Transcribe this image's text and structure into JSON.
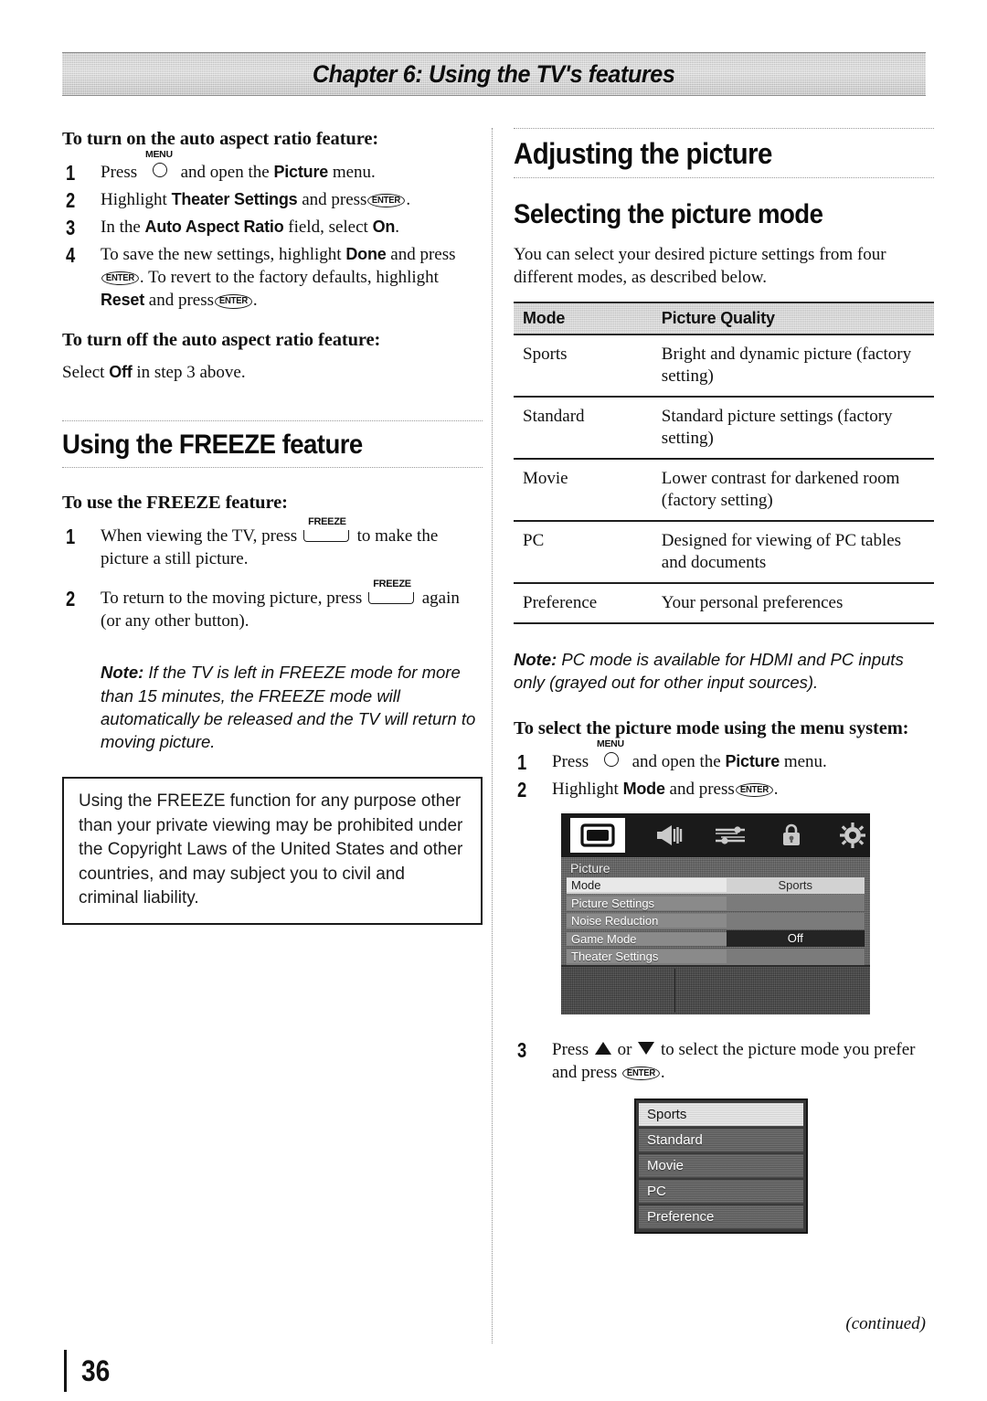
{
  "chapter_banner": "Chapter 6: Using the TV's features",
  "left_column": {
    "auto_aspect_on": {
      "heading": "To turn on the auto aspect ratio feature:",
      "steps": [
        {
          "num": "1",
          "pre": "Press",
          "key": "MENU",
          "mid": "and open the",
          "bold": "Picture",
          "post": "menu."
        },
        {
          "num": "2",
          "pre": "Highlight",
          "bold": "Theater Settings",
          "mid": "and press",
          "key": "ENTER",
          "post": "."
        },
        {
          "num": "3",
          "pre": "In the",
          "bold": "Auto Aspect Ratio",
          "mid": "field, select",
          "bold2": "On",
          "post": "."
        },
        {
          "num": "4",
          "pre": "To save the new settings, highlight",
          "bold": "Done",
          "mid": "and press",
          "key": "ENTER",
          "post": ". To revert to the factory defaults, highlight",
          "bold2": "Reset",
          "tail": "and press",
          "key2": "ENTER",
          "end": "."
        }
      ]
    },
    "auto_aspect_off": {
      "heading": "To turn off the auto aspect ratio feature:",
      "pre": "Select",
      "bold": "Off",
      "post": "in step 3 above."
    },
    "freeze_section": {
      "title": "Using the FREEZE feature",
      "sub_heading": "To use the FREEZE feature:",
      "steps": [
        {
          "num": "1",
          "pre": "When viewing the TV, press",
          "key": "FREEZE",
          "post": "to make the picture a still picture."
        },
        {
          "num": "2",
          "pre": "To return to the moving picture, press",
          "key": "FREEZE",
          "post": "again (or any other button)."
        }
      ],
      "note_label": "Note:",
      "note_text": "If the TV is left in FREEZE mode for more than 15 minutes, the FREEZE mode will automatically be released and the TV will return to moving picture."
    },
    "copyright_notice": "Using the FREEZE function for any purpose other than your private viewing may be prohibited under the Copyright Laws of the United States and other countries, and may subject you to civil and criminal liability."
  },
  "right_column": {
    "section_title": "Adjusting the picture",
    "subsection_title": "Selecting the picture mode",
    "intro": "You can select your desired picture settings from four different modes, as described below.",
    "table": {
      "headers": [
        "Mode",
        "Picture Quality"
      ],
      "rows": [
        [
          "Sports",
          "Bright and dynamic picture (factory setting)"
        ],
        [
          "Standard",
          "Standard picture settings (factory setting)"
        ],
        [
          "Movie",
          "Lower contrast for darkened room (factory setting)"
        ],
        [
          "PC",
          "Designed for viewing of PC tables and documents"
        ],
        [
          "Preference",
          "Your personal preferences"
        ]
      ]
    },
    "note_label": "Note:",
    "note_text": "PC mode is available for HDMI and PC inputs only (grayed out for other input sources).",
    "menu_heading": "To select the picture mode using the menu system:",
    "steps": [
      {
        "num": "1",
        "pre": "Press",
        "key": "MENU",
        "mid": "and open the",
        "bold": "Picture",
        "post": "menu."
      },
      {
        "num": "2",
        "pre": "Highlight",
        "bold": "Mode",
        "mid": "and press",
        "key": "ENTER",
        "post": "."
      },
      {
        "num": "3",
        "pre": "Press",
        "arrow_up": "up-triangle",
        "mid": "or",
        "arrow_down": "down-triangle",
        "post": "to select the picture mode you prefer and press",
        "key2": "ENTER",
        "end": "."
      }
    ],
    "osd": {
      "icons": [
        "picture-icon",
        "sound-icon",
        "settings-sliders-icon",
        "lock-icon",
        "setup-gear-icon"
      ],
      "title": "Picture",
      "rows": [
        {
          "label": "Mode",
          "value": "Sports",
          "state": "highlight"
        },
        {
          "label": "Picture Settings",
          "value": "",
          "state": "normal"
        },
        {
          "label": "Noise Reduction",
          "value": "",
          "state": "normal"
        },
        {
          "label": "Game Mode",
          "value": "Off",
          "state": "darkval"
        },
        {
          "label": "Theater Settings",
          "value": "",
          "state": "normal"
        }
      ]
    },
    "mode_list": {
      "items": [
        {
          "label": "Sports",
          "selected": true
        },
        {
          "label": "Standard",
          "selected": false
        },
        {
          "label": "Movie",
          "selected": false
        },
        {
          "label": "PC",
          "selected": false
        },
        {
          "label": "Preference",
          "selected": false
        }
      ]
    }
  },
  "footer": {
    "continued": "(continued)",
    "page_number": "36"
  }
}
